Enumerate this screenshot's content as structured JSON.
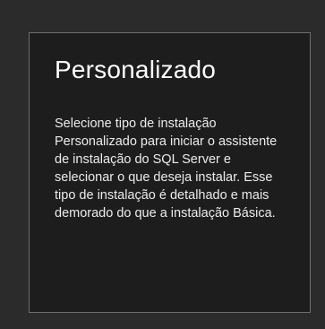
{
  "card": {
    "title": "Personalizado",
    "description": "Selecione tipo de instalação Personalizado para iniciar o assistente de instalação do SQL Server e selecionar o que deseja instalar. Esse tipo de instalação é detalhado e mais demorado do que a instalação Básica."
  },
  "colors": {
    "page_background": "#2b2b2b",
    "card_background": "#1d1d1d",
    "card_border": "#6e6e6e",
    "title_text": "#ffffff",
    "body_text": "#ececec"
  }
}
